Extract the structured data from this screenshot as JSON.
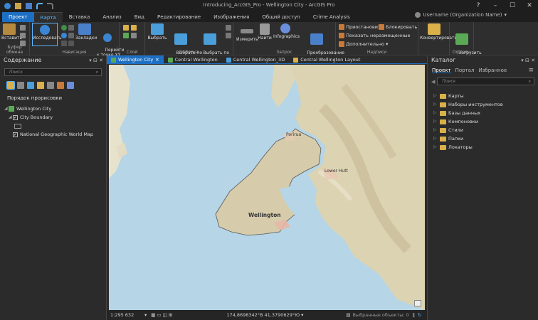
{
  "window": {
    "title": "Introducing_ArcGIS_Pro - Wellington City - ArcGIS Pro",
    "user": "Username (Organization Name)",
    "controls": [
      "?",
      "–",
      "☐",
      "✕"
    ]
  },
  "ribbon_tabs": [
    "Проект",
    "Карта",
    "Вставка",
    "Анализ",
    "Вид",
    "Редактирование",
    "Изображения",
    "Общий доступ",
    "Crime Analysis"
  ],
  "ribbon": {
    "paste": "Вставить",
    "clipboard": "Буфер обмена",
    "explore": "Исследовать",
    "bookmarks": "Закладки",
    "goto_xy": "Перейти\nк точке XY",
    "navigation": "Навигация",
    "layer": "Слой",
    "select": "Выбрать",
    "select_by_attr": "Выбрать по\nатрибуту",
    "select_by_loc": "Выбрать по\nрасположению",
    "selection": "Выборка",
    "measure": "Измерить",
    "locate": "Найти",
    "infographics": "Infographics",
    "convert_coords": "Преобразование\nкоординат",
    "inquiry": "Запрос",
    "pause": "Приостановить",
    "lock": "Блокировать",
    "show_unplaced": "Показать неразмещенные",
    "more": "Дополнительно",
    "labeling": "Надписи",
    "convert": "Конвертировать",
    "download_map": "Загрузить\nкарту",
    "offline": "Офлайн"
  },
  "contents": {
    "title": "Содержание",
    "search_placeholder": "Поиск",
    "draw_order": "Порядок прорисовки",
    "layers": [
      "Wellington City",
      "City Boundary",
      "National Geographic World Map"
    ]
  },
  "map_tabs": [
    "Wellington City",
    "Central Wellington",
    "Central Wellington_3D",
    "Central Wellington Layout"
  ],
  "map_labels": [
    "Porirua",
    "Lower Hutt",
    "Wellington"
  ],
  "status": {
    "scale": "1:295 632",
    "coords": "174,8698342°В 41,3790629°Ю",
    "selected": "Выбранные объекты: 0"
  },
  "catalog": {
    "title": "Каталог",
    "tabs": [
      "Проект",
      "Портал",
      "Избранное"
    ],
    "search_placeholder": "Поиск",
    "items": [
      "Карты",
      "Наборы инструментов",
      "Базы данных",
      "Компоновки",
      "Стили",
      "Папки",
      "Локаторы"
    ]
  }
}
